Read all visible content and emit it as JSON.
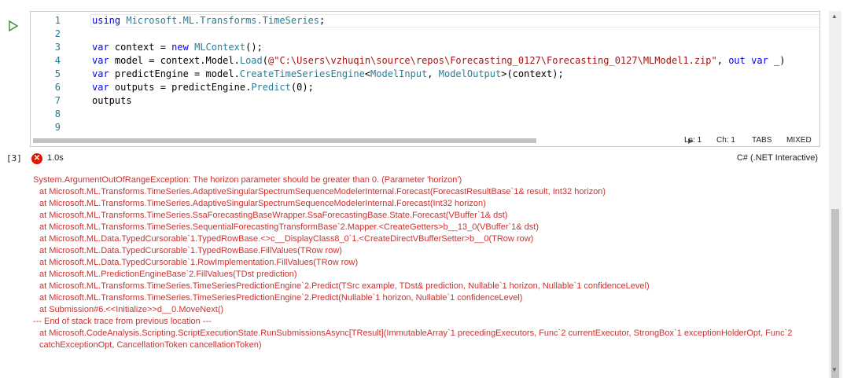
{
  "run_icon": "play-icon",
  "editor": {
    "line_numbers": [
      "1",
      "2",
      "3",
      "4",
      "5",
      "6",
      "7",
      "8",
      "9"
    ],
    "lines": [
      [
        {
          "c": "kw",
          "t": "using"
        },
        {
          "c": "tx",
          "t": " "
        },
        {
          "c": "ty",
          "t": "Microsoft.ML.Transforms.TimeSeries"
        },
        {
          "c": "tx",
          "t": ";"
        }
      ],
      [],
      [
        {
          "c": "kw",
          "t": "var"
        },
        {
          "c": "tx",
          "t": " context = "
        },
        {
          "c": "kw",
          "t": "new"
        },
        {
          "c": "tx",
          "t": " "
        },
        {
          "c": "ty",
          "t": "MLContext"
        },
        {
          "c": "tx",
          "t": "();"
        }
      ],
      [
        {
          "c": "kw",
          "t": "var"
        },
        {
          "c": "tx",
          "t": " model = context.Model."
        },
        {
          "c": "fn",
          "t": "Load"
        },
        {
          "c": "tx",
          "t": "("
        },
        {
          "c": "st",
          "t": "@\"C:\\Users\\vzhuqin\\source\\repos\\Forecasting_0127\\Forecasting_0127\\MLModel1.zip\""
        },
        {
          "c": "tx",
          "t": ", "
        },
        {
          "c": "kw",
          "t": "out"
        },
        {
          "c": "tx",
          "t": " "
        },
        {
          "c": "kw",
          "t": "var"
        },
        {
          "c": "tx",
          "t": " _)"
        }
      ],
      [
        {
          "c": "kw",
          "t": "var"
        },
        {
          "c": "tx",
          "t": " predictEngine = model."
        },
        {
          "c": "fn",
          "t": "CreateTimeSeriesEngine"
        },
        {
          "c": "tx",
          "t": "<"
        },
        {
          "c": "ty",
          "t": "ModelInput"
        },
        {
          "c": "tx",
          "t": ", "
        },
        {
          "c": "ty",
          "t": "ModelOutput"
        },
        {
          "c": "tx",
          "t": ">(context);"
        }
      ],
      [
        {
          "c": "kw",
          "t": "var"
        },
        {
          "c": "tx",
          "t": " outputs = predictEngine."
        },
        {
          "c": "fn",
          "t": "Predict"
        },
        {
          "c": "tx",
          "t": "(0);"
        }
      ],
      [
        {
          "c": "tx",
          "t": "outputs"
        }
      ],
      [],
      []
    ],
    "status": {
      "ln": "Ln: 1",
      "ch": "Ch: 1",
      "tabs": "TABS",
      "mixed": "MIXED"
    }
  },
  "cell": {
    "exec_count": "[3]",
    "status_icon": "error-icon",
    "exec_time": "1.0s",
    "kernel": "C# (.NET Interactive)"
  },
  "output_lines": [
    {
      "t": "System.ArgumentOutOfRangeException: The horizon parameter should be greater than 0. (Parameter 'horizon')",
      "indent": false
    },
    {
      "t": "at Microsoft.ML.Transforms.TimeSeries.AdaptiveSingularSpectrumSequenceModelerInternal.Forecast(ForecastResultBase`1& result, Int32 horizon)",
      "indent": true
    },
    {
      "t": "at Microsoft.ML.Transforms.TimeSeries.AdaptiveSingularSpectrumSequenceModelerInternal.Forecast(Int32 horizon)",
      "indent": true
    },
    {
      "t": "at Microsoft.ML.Transforms.TimeSeries.SsaForecastingBaseWrapper.SsaForecastingBase.State.Forecast(VBuffer`1& dst)",
      "indent": true
    },
    {
      "t": "at Microsoft.ML.Transforms.TimeSeries.SequentialForecastingTransformBase`2.Mapper.<CreateGetters>b__13_0(VBuffer`1& dst)",
      "indent": true
    },
    {
      "t": "at Microsoft.ML.Data.TypedCursorable`1.TypedRowBase.<>c__DisplayClass8_0`1.<CreateDirectVBufferSetter>b__0(TRow row)",
      "indent": true
    },
    {
      "t": "at Microsoft.ML.Data.TypedCursorable`1.TypedRowBase.FillValues(TRow row)",
      "indent": true
    },
    {
      "t": "at Microsoft.ML.Data.TypedCursorable`1.RowImplementation.FillValues(TRow row)",
      "indent": true
    },
    {
      "t": "at Microsoft.ML.PredictionEngineBase`2.FillValues(TDst prediction)",
      "indent": true
    },
    {
      "t": "at Microsoft.ML.Transforms.TimeSeries.TimeSeriesPredictionEngine`2.Predict(TSrc example, TDst& prediction, Nullable`1 horizon, Nullable`1 confidenceLevel)",
      "indent": true
    },
    {
      "t": "at Microsoft.ML.Transforms.TimeSeries.TimeSeriesPredictionEngine`2.Predict(Nullable`1 horizon, Nullable`1 confidenceLevel)",
      "indent": true
    },
    {
      "t": "at Submission#6.<<Initialize>>d__0.MoveNext()",
      "indent": true
    },
    {
      "t": "--- End of stack trace from previous location ---",
      "indent": false
    },
    {
      "t": "at Microsoft.CodeAnalysis.Scripting.ScriptExecutionState.RunSubmissionsAsync[TResult](ImmutableArray`1 precedingExecutors, Func`2 currentExecutor, StrongBox`1 exceptionHolderOpt, Func`2 catchExceptionOpt, CancellationToken cancellationToken)",
      "indent": true
    }
  ]
}
